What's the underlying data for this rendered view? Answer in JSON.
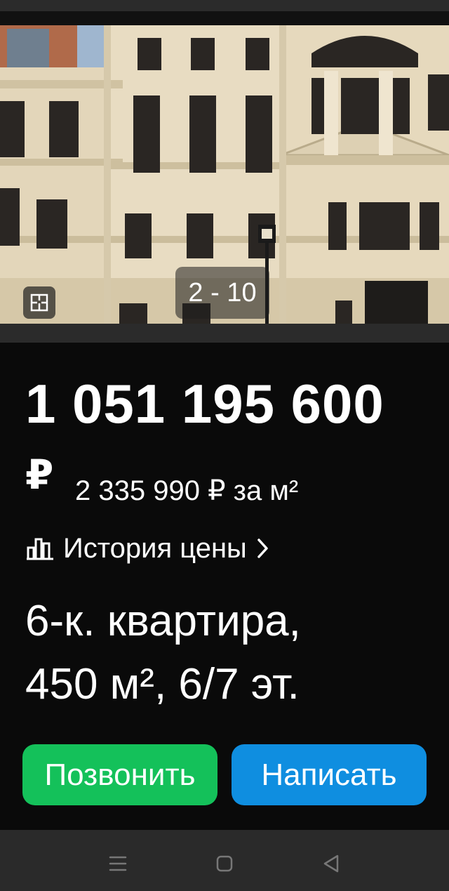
{
  "gallery": {
    "counter": "2 - 10",
    "plan_icon": "floor-plan-icon"
  },
  "listing": {
    "price": "1 051 195 600",
    "currency": "₽",
    "price_per_meter": "2 335 990 ₽ за м²",
    "price_history_label": "История цены",
    "title_line1": "6-к. квартира,",
    "title_line2": "450 м², 6/7 эт."
  },
  "actions": {
    "call_label": "Позвонить",
    "write_label": "Написать"
  },
  "colors": {
    "background": "#0a0a0a",
    "call_button": "#14c15a",
    "write_button": "#0f8ee0",
    "navbar": "#2a2a2a"
  },
  "navbar": {
    "icons": [
      "menu-icon",
      "home-icon",
      "back-icon"
    ]
  }
}
